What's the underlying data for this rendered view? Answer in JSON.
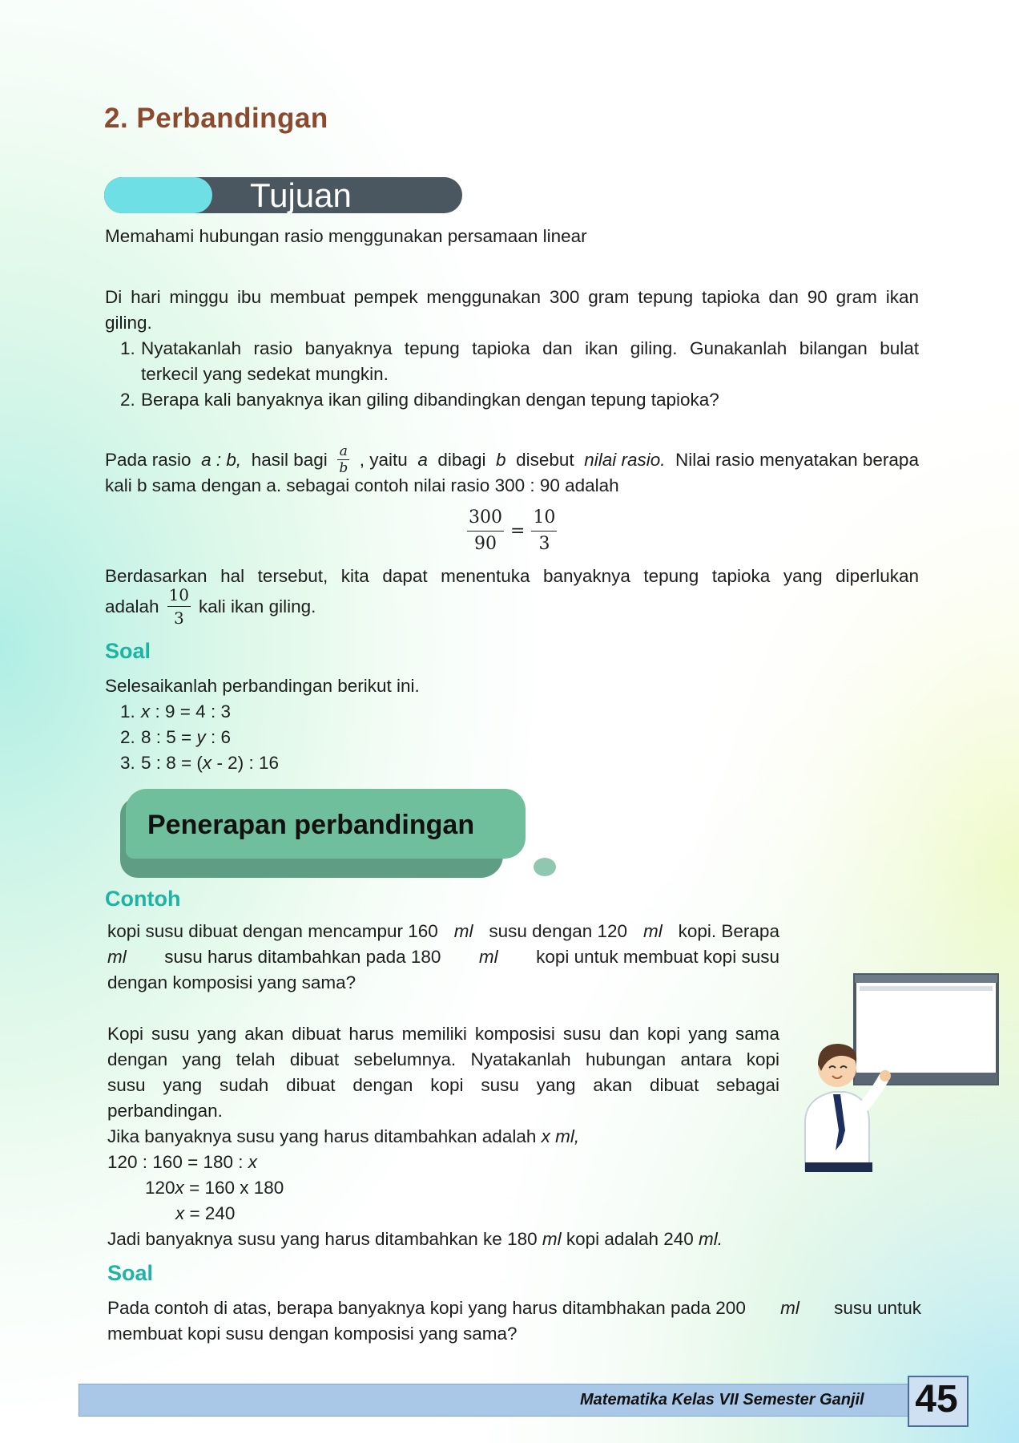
{
  "section_title": "2. Perbandingan",
  "tujuan": {
    "label": "Tujuan",
    "text": "Memahami hubungan rasio menggunakan persamaan linear"
  },
  "problem": {
    "intro_line1": "Di hari minggu ibu membuat pempek menggunakan 300 gram tepung tapioka dan 90 gram ikan",
    "intro_line2": "giling.",
    "items": [
      {
        "num": "1.",
        "line1": "Nyatakanlah rasio banyaknya tepung tapioka dan ikan giling. Gunakanlah bilangan bulat",
        "line2": "terkecil yang sedekat mungkin."
      },
      {
        "num": "2.",
        "line1": "Berapa kali banyaknya ikan giling dibandingkan dengan tepung tapioka?"
      }
    ]
  },
  "ratio": {
    "p1_a": "Pada rasio",
    "p1_ab": "a : b,",
    "p1_b": "hasil bagi",
    "frac_num": "a",
    "frac_den": "b",
    "p1_c": ", yaitu",
    "p1_a2": "a",
    "p1_d": "dibagi",
    "p1_b2": "b",
    "p1_e": "disebut",
    "p1_term": "nilai rasio.",
    "p1_f": "Nilai rasio menyatakan berapa",
    "p1_line2": "kali b sama dengan a. sebagai contoh nilai rasio 300 : 90 adalah",
    "eq_num1": "300",
    "eq_den1": "90",
    "eq_sign": "=",
    "eq_num2": "10",
    "eq_den2": "3",
    "p2_line1": "Berdasarkan hal tersebut, kita dapat menentuka banyaknya tepung tapioka yang diperlukan",
    "p2_a": "adalah",
    "p2_num": "10",
    "p2_den": "3",
    "p2_b": "kali ikan giling."
  },
  "soal1": {
    "heading": "Soal",
    "intro": "Selesaikanlah perbandingan berikut ini.",
    "items": [
      {
        "num": "1.",
        "var": "x",
        "rest": ": 9 = 4 : 3"
      },
      {
        "num": "2.",
        "pre": "8 : 5 =",
        "var": "y",
        "rest": ": 6"
      },
      {
        "num": "3.",
        "pre": "5 : 8 = (",
        "var": "x",
        "rest": "- 2) : 16"
      }
    ]
  },
  "banner": "Penerapan perbandingan",
  "contoh": {
    "heading": "Contoh",
    "q_line1_a": "kopi susu dibuat dengan mencampur 160",
    "ml": "ml",
    "q_line1_b": "susu dengan 120",
    "q_line1_c": "kopi. Berapa",
    "q_line2_b": "susu harus ditambahkan  pada 180",
    "q_line2_c": "kopi untuk membuat kopi susu",
    "q_line3": "dengan komposisi yang sama?",
    "a_lines": [
      "Kopi susu yang akan dibuat harus memiliki komposisi susu dan kopi yang sama",
      "dengan yang telah dibuat sebelumnya. Nyatakanlah hubungan antara kopi",
      "susu yang sudah dibuat dengan kopi susu yang akan dibuat sebagai",
      "perbandingan."
    ],
    "let_a": "Jika banyaknya susu yang harus ditambahkan adalah",
    "let_var": "x ml,",
    "eq1": "120 : 160 = 180 :",
    "eq_x": "x",
    "eq2_a": "120",
    "eq2_b": "= 160 x 180",
    "eq3": "= 240",
    "concl_a": "Jadi banyaknya susu yang harus ditambahkan ke 180",
    "concl_b": "kopi adalah 240",
    "concl_ml_end": "ml."
  },
  "soal2": {
    "heading": "Soal",
    "line1_a": "Pada contoh di atas, berapa banyaknya kopi yang harus ditambhakan pada 200",
    "ml": "ml",
    "line1_b": "susu untuk",
    "line2": "membuat kopi susu dengan komposisi yang sama?"
  },
  "footer": {
    "book": "Matematika Kelas VII Semester Ganjil",
    "page": "45"
  },
  "colors": {
    "title": "#8b4a2e",
    "teal": "#1fb3a4",
    "pill_dark": "#4a5760",
    "pill_cyan": "#6fdfe6",
    "banner": "#6fbe9c"
  }
}
